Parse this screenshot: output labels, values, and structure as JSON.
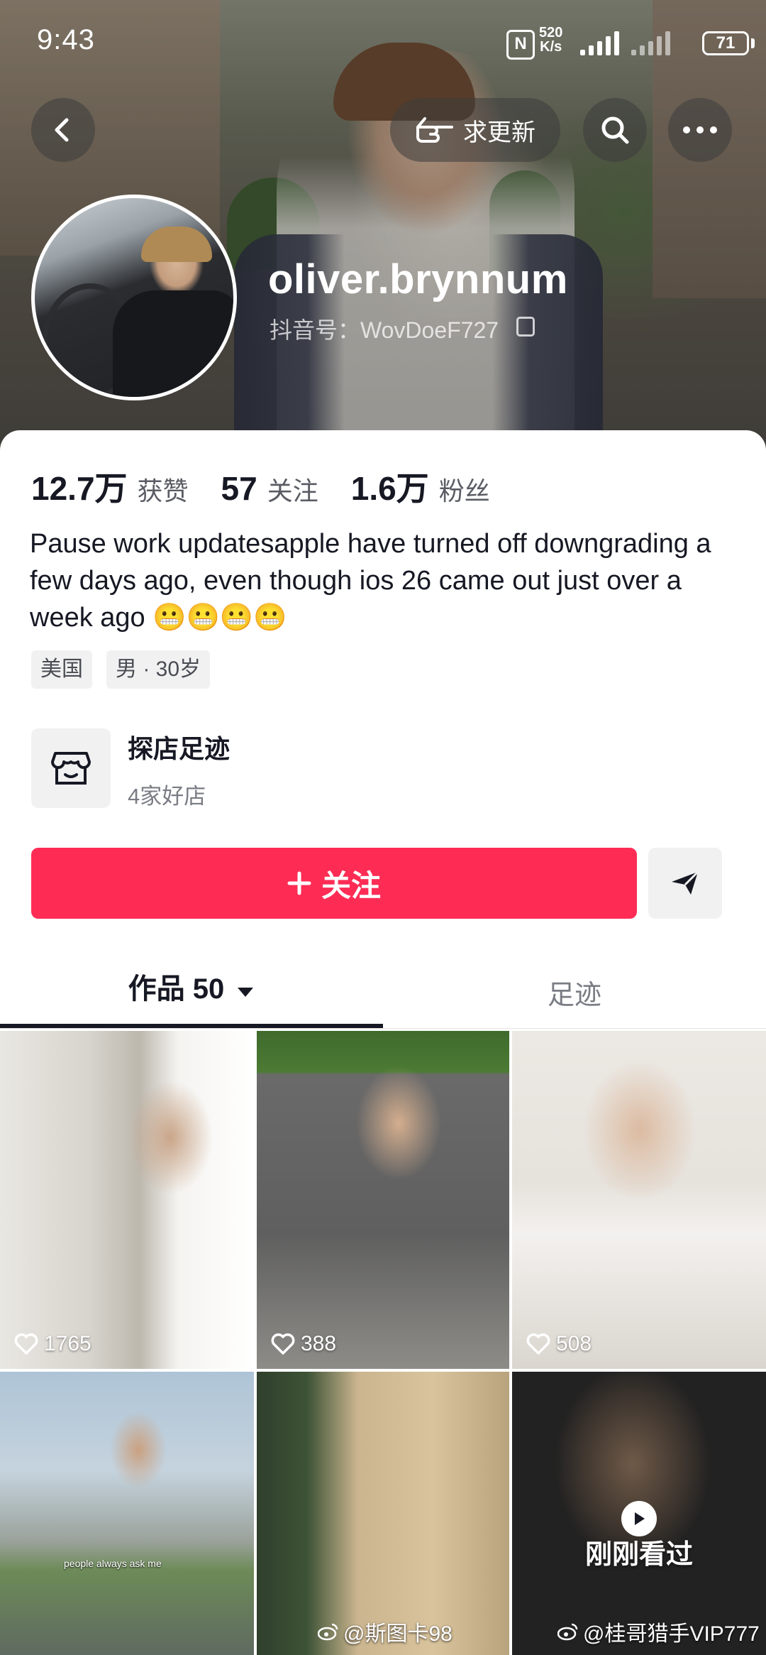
{
  "status_bar": {
    "time": "9:43",
    "speed_value": "520",
    "speed_unit": "K/s",
    "battery": "71"
  },
  "header": {
    "update_label": "求更新"
  },
  "profile": {
    "username": "oliver.brynnum",
    "douyin_id": "抖音号：WovDoeF727",
    "stats": [
      {
        "value": "12.7万",
        "label": "获赞"
      },
      {
        "value": "57",
        "label": "关注"
      },
      {
        "value": "1.6万",
        "label": "粉丝"
      }
    ],
    "bio": "Pause work updatesapple have turned off downgrading a few days ago, even though ios 26 came out just over a week ago 😬😬😬😬",
    "tags": [
      "美国",
      "男 · 30岁"
    ]
  },
  "shop": {
    "title": "探店足迹",
    "subtitle": "4家好店"
  },
  "actions": {
    "follow_label": "关注"
  },
  "tabs": {
    "works_label": "作品 50",
    "footprint_label": "足迹"
  },
  "videos": [
    {
      "likes": "1765"
    },
    {
      "likes": "388"
    },
    {
      "likes": "508"
    },
    {
      "caption": "people always ask me"
    },
    {},
    {
      "recent_label": "刚刚看过"
    }
  ],
  "watermarks": [
    "@斯图卡98",
    "@桂哥猎手VIP777"
  ]
}
